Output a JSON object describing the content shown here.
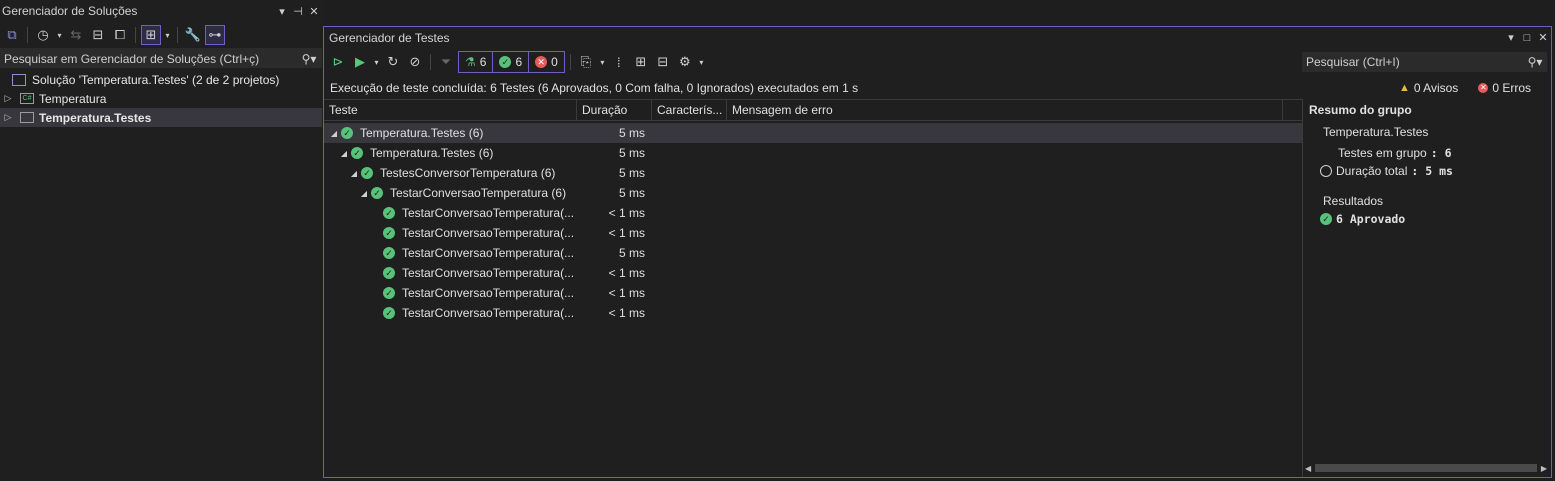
{
  "solution_explorer": {
    "title": "Gerenciador de Soluções",
    "search_placeholder": "Pesquisar em Gerenciador de Soluções (Ctrl+ç)",
    "solution_label": "Solução 'Temperatura.Testes' (2 de 2 projetos)",
    "projects": [
      {
        "name": "Temperatura",
        "selected": false
      },
      {
        "name": "Temperatura.Testes",
        "selected": true
      }
    ]
  },
  "test_explorer": {
    "title": "Gerenciador de Testes",
    "counters": {
      "total": "6",
      "passed": "6",
      "failed": "0"
    },
    "search_placeholder": "Pesquisar (Ctrl+I)",
    "status_message": "Execução de teste concluída: 6 Testes (6 Aprovados, 0 Com falha, 0 Ignorados) executados em 1 s",
    "warnings": "0 Avisos",
    "errors": "0 Erros",
    "columns": [
      "Teste",
      "Duração",
      "Caracterís...",
      "Mensagem de erro"
    ],
    "rows": [
      {
        "name": "Temperatura.Testes  (6)",
        "duration": "5 ms"
      },
      {
        "name": "Temperatura.Testes  (6)",
        "duration": "5 ms"
      },
      {
        "name": "TestesConversorTemperatura  (6)",
        "duration": "5 ms"
      },
      {
        "name": "TestarConversaoTemperatura  (6)",
        "duration": "5 ms"
      },
      {
        "name": "TestarConversaoTemperatura(...",
        "duration": "< 1 ms"
      },
      {
        "name": "TestarConversaoTemperatura(...",
        "duration": "< 1 ms"
      },
      {
        "name": "TestarConversaoTemperatura(...",
        "duration": "5 ms"
      },
      {
        "name": "TestarConversaoTemperatura(...",
        "duration": "< 1 ms"
      },
      {
        "name": "TestarConversaoTemperatura(...",
        "duration": "< 1 ms"
      },
      {
        "name": "TestarConversaoTemperatura(...",
        "duration": "< 1 ms"
      }
    ],
    "summary": {
      "heading": "Resumo do grupo",
      "group_name": "Temperatura.Testes",
      "tests_label": "Testes em grupo",
      "tests_value": ": 6",
      "duration_label": "Duração total",
      "duration_value": ": 5 ms",
      "results_label": "Resultados",
      "passed": "6 Aprovado"
    }
  },
  "colors": {
    "accent": "#6c5fc7",
    "passed": "#58c27a",
    "failed": "#e35b5b",
    "warning": "#e8b64a"
  }
}
